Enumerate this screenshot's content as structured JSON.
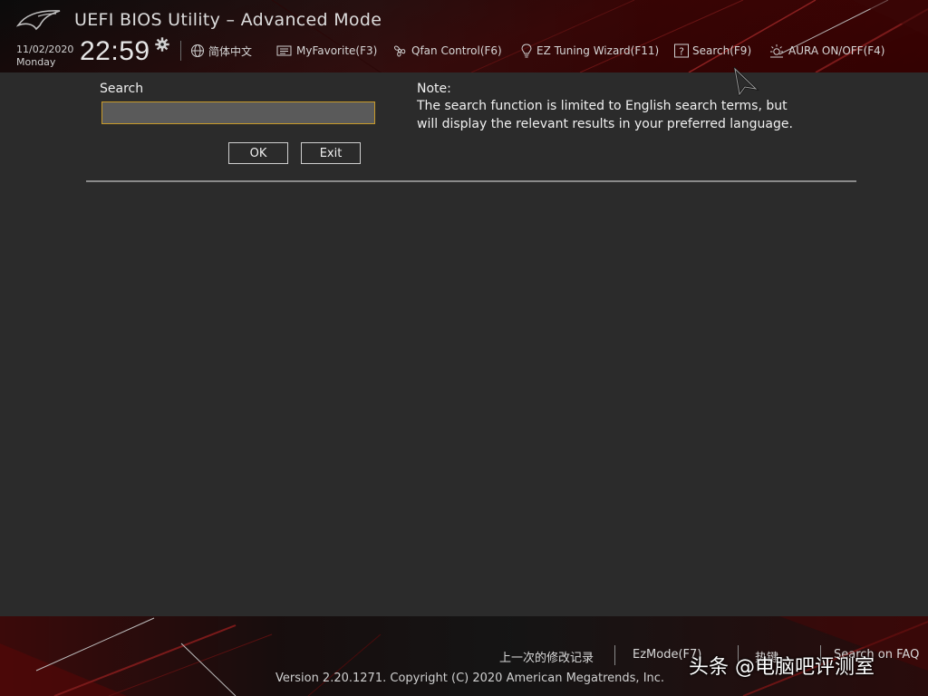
{
  "header": {
    "title": "UEFI BIOS Utility – Advanced Mode",
    "date": "11/02/2020",
    "weekday": "Monday",
    "time": "22:59",
    "toolbar": [
      {
        "label": "简体中文",
        "icon": "globe-icon"
      },
      {
        "label": "MyFavorite(F3)",
        "icon": "favorite-icon"
      },
      {
        "label": "Qfan Control(F6)",
        "icon": "fan-icon"
      },
      {
        "label": "EZ Tuning Wizard(F11)",
        "icon": "lightbulb-icon"
      },
      {
        "label": "Search(F9)",
        "icon": "question-icon"
      },
      {
        "label": "AURA ON/OFF(F4)",
        "icon": "aura-icon"
      }
    ]
  },
  "search": {
    "label": "Search",
    "value": "",
    "placeholder": "",
    "ok_label": "OK",
    "exit_label": "Exit"
  },
  "note": {
    "title": "Note:",
    "body": "The search function is limited to English search terms, but will display the relevant results in your preferred language."
  },
  "footer": {
    "links": [
      "上一次的修改记录",
      "EzMode(F7)",
      "热键",
      "Search on FAQ"
    ],
    "version": "Version 2.20.1271. Copyright (C) 2020 American Megatrends, Inc.",
    "watermark": "头条 @电脑吧评测室"
  },
  "colors": {
    "accent": "#c89a2a",
    "header_red": "#7a0000",
    "background": "#2b2b2b"
  }
}
